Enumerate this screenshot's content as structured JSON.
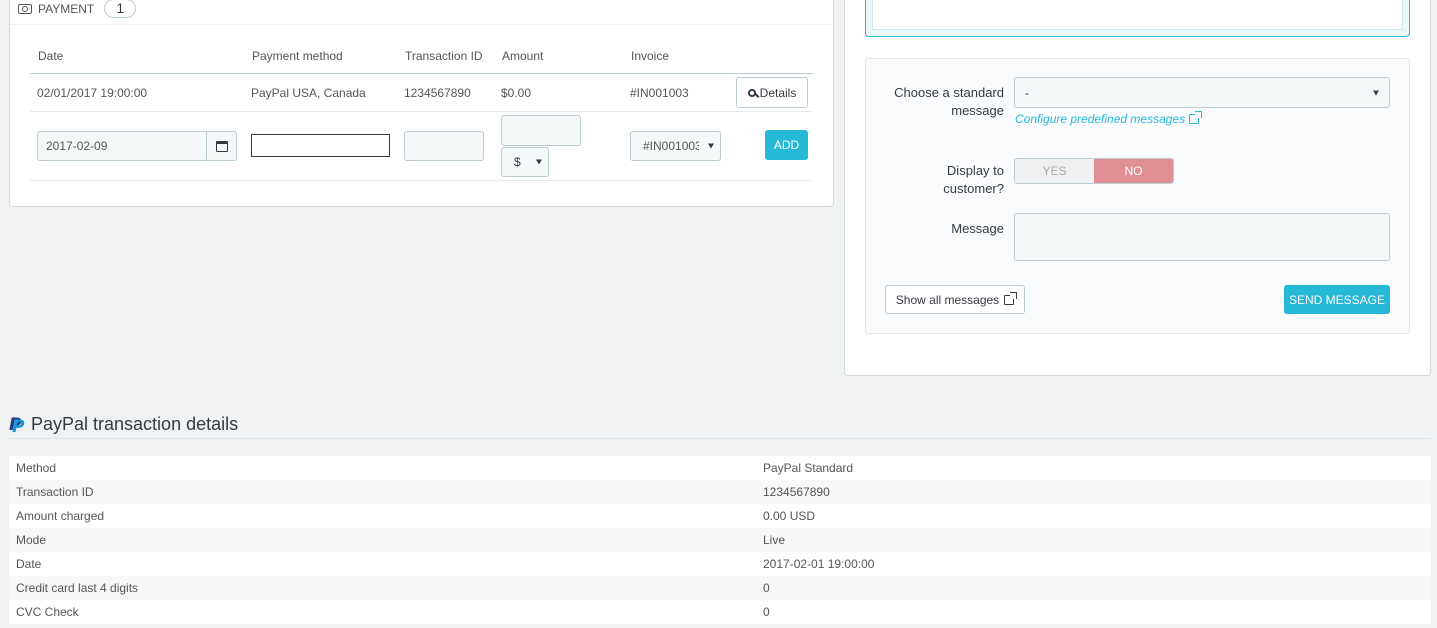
{
  "payment": {
    "title": "Payment",
    "count": "1",
    "columns": {
      "date": "Date",
      "method": "Payment method",
      "transaction": "Transaction ID",
      "amount": "Amount",
      "invoice": "Invoice"
    },
    "row": {
      "date": "02/01/2017 19:00:00",
      "method": "PayPal USA, Canada",
      "transaction": "1234567890",
      "amount": "$0.00",
      "invoice": "#IN001003",
      "details_label": "Details"
    },
    "form": {
      "date_value": "2017-02-09",
      "currency": "$",
      "invoice_value": "#IN001003",
      "add_label": "ADD"
    }
  },
  "message": {
    "standard_label": "Choose a standard message",
    "standard_value": "-",
    "configure_link": "Configure predefined messages",
    "display_label": "Display to customer?",
    "yes": "YES",
    "no": "NO",
    "message_label": "Message",
    "show_all": "Show all messages",
    "send": "SEND MESSAGE"
  },
  "paypal": {
    "title": "PayPal transaction details",
    "rows": [
      {
        "k": "Method",
        "v": "PayPal Standard"
      },
      {
        "k": "Transaction ID",
        "v": "1234567890"
      },
      {
        "k": "Amount charged",
        "v": "0.00 USD"
      },
      {
        "k": "Mode",
        "v": "Live"
      },
      {
        "k": "Date",
        "v": "2017-02-01 19:00:00"
      },
      {
        "k": "Credit card last 4 digits",
        "v": "0"
      },
      {
        "k": "CVC Check",
        "v": "0"
      }
    ]
  },
  "colors": {
    "accent": "#25b9d7",
    "no_toggle": "#e08f95",
    "background": "#eff1f2"
  }
}
